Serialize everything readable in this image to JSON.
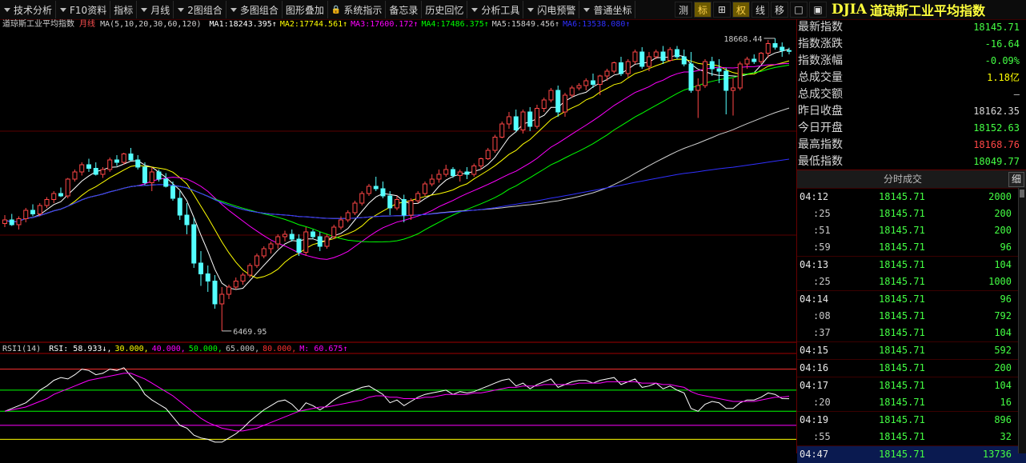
{
  "colors": {
    "up": "#ff4646",
    "down": "#54ffff",
    "ma1": "#ffffff",
    "ma2": "#ffff00",
    "ma3": "#ff00ff",
    "ma4": "#00ff00",
    "ma5": "#d0d0d0",
    "ma6": "#3030ff",
    "rsi": "#ffffff",
    "rsi_ma": "#ff00ff"
  },
  "toolbar": {
    "menus": [
      {
        "label": "技术分析",
        "dd": true
      },
      {
        "label": "F10资料",
        "dd": true
      },
      {
        "label": "指标",
        "dd": false
      },
      {
        "label": "月线",
        "dd": true
      },
      {
        "label": "2图组合",
        "dd": true
      },
      {
        "label": "多图组合",
        "dd": true
      },
      {
        "label": "图形叠加",
        "dd": false
      },
      {
        "label": "系统指示",
        "dd": false,
        "icon": "lock-icon"
      },
      {
        "label": "备忘录",
        "dd": false
      },
      {
        "label": "历史回忆",
        "dd": false
      },
      {
        "label": "分析工具",
        "dd": true
      },
      {
        "label": "闪电预警",
        "dd": true
      },
      {
        "label": "普通坐标",
        "dd": true
      }
    ],
    "tools": [
      {
        "label": "测",
        "active": false
      },
      {
        "label": "标",
        "active": true
      },
      {
        "label": "⊞",
        "active": false
      },
      {
        "label": "权",
        "active": true
      },
      {
        "label": "线",
        "active": false
      },
      {
        "label": "移",
        "active": false
      },
      {
        "label": "□",
        "active": false
      },
      {
        "label": "▣",
        "active": false
      }
    ]
  },
  "instrument": {
    "code": "DJIA",
    "name": "道琼斯工业平均指数"
  },
  "chart_legend": {
    "name": "道琼斯工业平均指数",
    "period": "月线",
    "ma_params": "MA(5,10,20,30,60,120)",
    "mas": [
      {
        "label": "MA1:",
        "value": "18243.395↑",
        "color": "#ffffff"
      },
      {
        "label": "MA2:",
        "value": "17744.561↑",
        "color": "#ffff00"
      },
      {
        "label": "MA3:",
        "value": "17600.172↑",
        "color": "#ff00ff"
      },
      {
        "label": "MA4:",
        "value": "17486.375↑",
        "color": "#00ff00"
      },
      {
        "label": "MA5:",
        "value": "15849.456↑",
        "color": "#d0d0d0"
      },
      {
        "label": "MA6:",
        "value": "13538.080↑",
        "color": "#3030ff"
      }
    ]
  },
  "rsi_legend": {
    "name": "RSI1(14)",
    "items": [
      {
        "text": "RSI: 58.933↓,",
        "color": "#ffffff"
      },
      {
        "text": "30.000,",
        "color": "#ffff00"
      },
      {
        "text": "40.000,",
        "color": "#ff00ff"
      },
      {
        "text": "50.000,",
        "color": "#00ff00"
      },
      {
        "text": "65.000,",
        "color": "#c0c0c0"
      },
      {
        "text": "80.000,",
        "color": "#ff3030"
      },
      {
        "text": "M: 60.675↑",
        "color": "#ff00ff"
      }
    ]
  },
  "quote": [
    {
      "label": "最新指数",
      "value": "18145.71",
      "color": "#44ff44"
    },
    {
      "label": "指数涨跌",
      "value": "-16.64",
      "color": "#44ff44"
    },
    {
      "label": "指数涨幅",
      "value": "-0.09%",
      "color": "#44ff44"
    },
    {
      "label": "总成交量",
      "value": "1.18亿",
      "color": "#ffff00"
    },
    {
      "label": "总成交额",
      "value": "—",
      "color": "#c0c0c0"
    },
    {
      "label": "昨日收盘",
      "value": "18162.35",
      "color": "#d8d8d8"
    },
    {
      "label": "今日开盘",
      "value": "18152.63",
      "color": "#44ff44"
    },
    {
      "label": "最高指数",
      "value": "18168.76",
      "color": "#ff4646"
    },
    {
      "label": "最低指数",
      "value": "18049.77",
      "color": "#44ff44"
    }
  ],
  "trades_header": {
    "title": "分时成交",
    "detail": "细"
  },
  "trades": [
    {
      "time": "04:12",
      "price": "18145.71",
      "vol": "2000",
      "sub": false
    },
    {
      "time": ":25",
      "price": "18145.71",
      "vol": "200",
      "sub": true
    },
    {
      "time": ":51",
      "price": "18145.71",
      "vol": "200",
      "sub": true
    },
    {
      "time": ":59",
      "price": "18145.71",
      "vol": "96",
      "sub": true
    },
    {
      "time": "04:13",
      "price": "18145.71",
      "vol": "104",
      "sub": false
    },
    {
      "time": ":25",
      "price": "18145.71",
      "vol": "1000",
      "sub": true
    },
    {
      "time": "04:14",
      "price": "18145.71",
      "vol": "96",
      "sub": false
    },
    {
      "time": ":08",
      "price": "18145.71",
      "vol": "792",
      "sub": true
    },
    {
      "time": ":37",
      "price": "18145.71",
      "vol": "104",
      "sub": true
    },
    {
      "time": "04:15",
      "price": "18145.71",
      "vol": "592",
      "sub": false
    },
    {
      "time": "04:16",
      "price": "18145.71",
      "vol": "200",
      "sub": false
    },
    {
      "time": "04:17",
      "price": "18145.71",
      "vol": "104",
      "sub": false
    },
    {
      "time": ":20",
      "price": "18145.71",
      "vol": "16",
      "sub": true
    },
    {
      "time": "04:19",
      "price": "18145.71",
      "vol": "896",
      "sub": false
    },
    {
      "time": ":55",
      "price": "18145.71",
      "vol": "32",
      "sub": true
    },
    {
      "time": "04:47",
      "price": "18145.71",
      "vol": "13736",
      "sub": false,
      "last": true
    }
  ],
  "chart_data": [
    {
      "type": "candlestick",
      "ohlc": [
        [
          10950,
          11300,
          10800,
          11100
        ],
        [
          11100,
          11350,
          10850,
          10900
        ],
        [
          10900,
          11250,
          10700,
          11150
        ],
        [
          11150,
          11600,
          11000,
          11500
        ],
        [
          11500,
          11750,
          11250,
          11350
        ],
        [
          11350,
          11800,
          11250,
          11700
        ],
        [
          11700,
          12050,
          11600,
          11950
        ],
        [
          11950,
          12300,
          11800,
          12200
        ],
        [
          12200,
          12450,
          12050,
          12100
        ],
        [
          12100,
          12850,
          12000,
          12800
        ],
        [
          12800,
          13200,
          12700,
          13100
        ],
        [
          13100,
          13500,
          12950,
          13400
        ],
        [
          13400,
          13650,
          13100,
          13250
        ],
        [
          13250,
          13500,
          12950,
          13000
        ],
        [
          13000,
          13300,
          12850,
          13200
        ],
        [
          13200,
          13700,
          13100,
          13600
        ],
        [
          13600,
          13800,
          13350,
          13500
        ],
        [
          13500,
          13900,
          13400,
          13850
        ],
        [
          13850,
          14100,
          13550,
          13600
        ],
        [
          13600,
          13800,
          13200,
          13300
        ],
        [
          13300,
          13500,
          12550,
          12650
        ],
        [
          12650,
          13300,
          12300,
          13100
        ],
        [
          13100,
          13200,
          12700,
          12800
        ],
        [
          12800,
          13050,
          12450,
          12500
        ],
        [
          12500,
          12700,
          11900,
          12000
        ],
        [
          12000,
          12300,
          11100,
          11300
        ],
        [
          11300,
          11800,
          10500,
          10900
        ],
        [
          10900,
          11200,
          9100,
          9300
        ],
        [
          9300,
          9800,
          8350,
          8850
        ],
        [
          8850,
          9200,
          8100,
          8550
        ],
        [
          8550,
          8800,
          7400,
          7600
        ],
        [
          7600,
          8300,
          6469.95,
          8000
        ],
        [
          8000,
          8400,
          7800,
          8300
        ],
        [
          8300,
          8700,
          8200,
          8550
        ],
        [
          8550,
          8900,
          8400,
          8800
        ],
        [
          8800,
          9300,
          8700,
          9200
        ],
        [
          9200,
          9700,
          9100,
          9600
        ],
        [
          9600,
          10000,
          9500,
          9900
        ],
        [
          9900,
          10200,
          9700,
          10100
        ],
        [
          10100,
          10500,
          9900,
          10400
        ],
        [
          10400,
          10650,
          10200,
          10500
        ],
        [
          10500,
          10700,
          10200,
          10300
        ],
        [
          10300,
          10500,
          9600,
          9750
        ],
        [
          9750,
          10800,
          9600,
          10600
        ],
        [
          10600,
          10700,
          10300,
          10400
        ],
        [
          10400,
          10600,
          9800,
          10000
        ],
        [
          10000,
          10500,
          9900,
          10400
        ],
        [
          10400,
          10900,
          10300,
          10800
        ],
        [
          10800,
          11250,
          10700,
          11100
        ],
        [
          11100,
          11500,
          11000,
          11400
        ],
        [
          11400,
          11900,
          11300,
          11800
        ],
        [
          11800,
          12300,
          11700,
          12200
        ],
        [
          12200,
          12600,
          12100,
          12500
        ],
        [
          12500,
          12900,
          12300,
          12400
        ],
        [
          12400,
          12700,
          12000,
          12100
        ],
        [
          12100,
          12300,
          11300,
          11600
        ],
        [
          11600,
          12100,
          11500,
          11950
        ],
        [
          11950,
          12150,
          11000,
          11300
        ],
        [
          11300,
          12000,
          11100,
          11900
        ],
        [
          11900,
          12300,
          11800,
          12200
        ],
        [
          12200,
          12700,
          12100,
          12600
        ],
        [
          12600,
          13000,
          12500,
          12800
        ],
        [
          12800,
          13200,
          12650,
          13000
        ],
        [
          13000,
          13400,
          12900,
          13200
        ],
        [
          13200,
          13300,
          12850,
          12950
        ],
        [
          12950,
          13200,
          12700,
          13100
        ],
        [
          13100,
          13300,
          12800,
          13000
        ],
        [
          13000,
          13450,
          12900,
          13350
        ],
        [
          13350,
          13700,
          13200,
          13650
        ],
        [
          13650,
          14100,
          13600,
          14000
        ],
        [
          14000,
          14650,
          13900,
          14550
        ],
        [
          14550,
          15200,
          14500,
          15100
        ],
        [
          15100,
          15600,
          14900,
          15400
        ],
        [
          15400,
          15700,
          14750,
          14850
        ],
        [
          14850,
          15700,
          14700,
          15600
        ],
        [
          15600,
          15800,
          14800,
          15000
        ],
        [
          15000,
          15900,
          14900,
          15750
        ],
        [
          15750,
          16200,
          15600,
          16100
        ],
        [
          16100,
          16600,
          16000,
          16500
        ],
        [
          16500,
          16700,
          15400,
          15600
        ],
        [
          15600,
          16400,
          15400,
          16300
        ],
        [
          16300,
          16700,
          16200,
          16600
        ],
        [
          16600,
          16800,
          16500,
          16700
        ],
        [
          16700,
          17000,
          16500,
          16900
        ],
        [
          16900,
          17200,
          16600,
          16750
        ],
        [
          16750,
          17150,
          16300,
          17100
        ],
        [
          17100,
          17400,
          16900,
          17300
        ],
        [
          17300,
          17700,
          17200,
          17650
        ],
        [
          17650,
          17900,
          17100,
          17200
        ],
        [
          17200,
          17800,
          17050,
          17700
        ],
        [
          17700,
          18200,
          17600,
          18100
        ],
        [
          18100,
          18300,
          17400,
          17500
        ],
        [
          17500,
          18100,
          17300,
          17900
        ],
        [
          17900,
          18200,
          17800,
          18100
        ],
        [
          18100,
          18350,
          17600,
          17750
        ],
        [
          17750,
          18300,
          17700,
          18200
        ],
        [
          18200,
          18350,
          17800,
          17900
        ],
        [
          17900,
          18200,
          17500,
          17600
        ],
        [
          17600,
          18100,
          16400,
          16500
        ],
        [
          16500,
          17000,
          15350,
          16700
        ],
        [
          16700,
          17800,
          16600,
          17700
        ],
        [
          17700,
          17900,
          17100,
          17400
        ],
        [
          17400,
          17800,
          16800,
          17300
        ],
        [
          17300,
          17450,
          15500,
          16500
        ],
        [
          16500,
          17000,
          15450,
          16600
        ],
        [
          16600,
          17700,
          16500,
          17600
        ],
        [
          17600,
          17900,
          17400,
          17800
        ],
        [
          17800,
          18000,
          17600,
          17700
        ],
        [
          17700,
          18100,
          17600,
          18050
        ],
        [
          18050,
          18600,
          17850,
          18450
        ],
        [
          18450,
          18668.44,
          18200,
          18300
        ],
        [
          18300,
          18500,
          17900,
          18160
        ],
        [
          18160,
          18280,
          18000,
          18145.71
        ]
      ],
      "low_label": "6469.95",
      "high_label": "18668.44"
    },
    {
      "type": "line",
      "name": "RSI1(14)",
      "ylim": [
        20,
        90
      ],
      "rsi": [
        50,
        52,
        54,
        56,
        60,
        65,
        68,
        72,
        74,
        73,
        76,
        80,
        79,
        76,
        77,
        80,
        79,
        81,
        75,
        70,
        62,
        58,
        55,
        52,
        46,
        40,
        38,
        33,
        31,
        30,
        28,
        28,
        31,
        34,
        38,
        43,
        47,
        51,
        54,
        57,
        58,
        55,
        50,
        56,
        54,
        51,
        54,
        58,
        61,
        63,
        65,
        67,
        68,
        65,
        62,
        56,
        58,
        54,
        57,
        60,
        62,
        63,
        64,
        65,
        62,
        64,
        63,
        64,
        66,
        68,
        70,
        72,
        73,
        68,
        70,
        66,
        69,
        71,
        73,
        67,
        69,
        71,
        72,
        72,
        70,
        72,
        73,
        74,
        69,
        71,
        73,
        67,
        68,
        70,
        66,
        68,
        65,
        63,
        52,
        50,
        55,
        57,
        56,
        52,
        52,
        56,
        58,
        58,
        60,
        63,
        62,
        59,
        58.93
      ],
      "m": [
        50,
        51,
        52,
        53,
        55,
        57,
        59,
        62,
        64,
        66,
        68,
        70,
        72,
        73,
        74,
        75,
        76,
        77,
        77,
        75,
        73,
        70,
        67,
        64,
        61,
        57,
        53,
        49,
        45,
        42,
        40,
        38,
        37,
        36,
        36,
        37,
        38,
        40,
        42,
        44,
        46,
        48,
        50,
        51,
        52,
        53,
        53,
        54,
        55,
        56,
        57,
        58,
        60,
        61,
        61,
        60,
        60,
        59,
        59,
        59,
        60,
        60,
        61,
        62,
        62,
        62,
        62,
        63,
        63,
        64,
        65,
        66,
        67,
        67,
        68,
        68,
        68,
        69,
        69,
        69,
        69,
        69,
        70,
        70,
        70,
        70,
        71,
        71,
        71,
        71,
        71,
        70,
        70,
        70,
        69,
        69,
        68,
        67,
        64,
        62,
        61,
        60,
        59,
        58,
        57,
        57,
        57,
        57,
        58,
        59,
        60,
        60,
        60.68
      ],
      "levels": [
        30,
        40,
        50,
        65,
        80
      ]
    }
  ]
}
